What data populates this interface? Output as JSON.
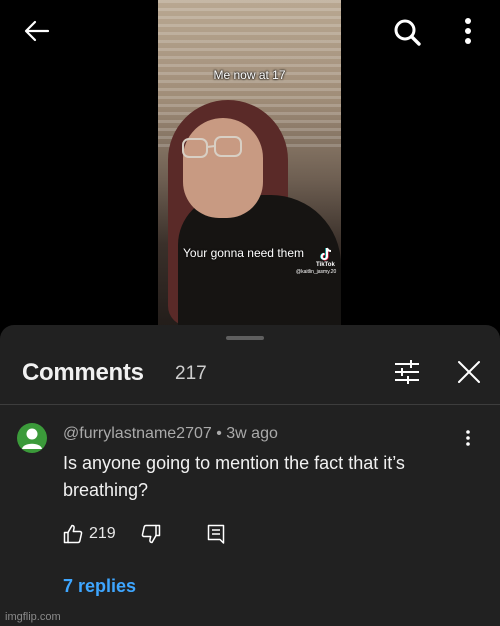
{
  "video": {
    "caption_top": "Me now at 17",
    "caption_bottom": "Your gonna need them",
    "tiktok_label": "TikTok",
    "tiktok_handle": "@kaitlin_jasmy.20"
  },
  "top_bar": {
    "back_icon": "arrow-left-icon",
    "search_icon": "search-icon",
    "more_icon": "more-vertical-icon"
  },
  "comments": {
    "title": "Comments",
    "count": "217",
    "filter_icon": "tune-icon",
    "close_icon": "close-icon"
  },
  "comment": {
    "author": "@furrylastname2707",
    "separator": " • ",
    "time": "3w ago",
    "text": "Is anyone going to mention the fact that it’s breathing?",
    "likes": "219",
    "replies_label": "7 replies"
  },
  "watermark": "imgflip.com",
  "colors": {
    "sheet_bg": "#212121",
    "link_blue": "#3ea6ff",
    "avatar_green": "#3b9a3a"
  }
}
